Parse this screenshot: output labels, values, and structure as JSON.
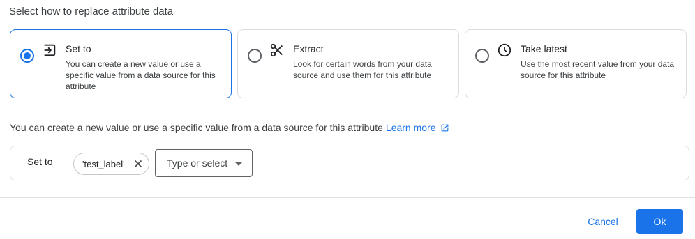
{
  "heading": "Select how to replace attribute data",
  "options": [
    {
      "title": "Set to",
      "description": "You can create a new value or use a specific value from a data source for this attribute",
      "icon": "input-arrow-icon",
      "selected": true
    },
    {
      "title": "Extract",
      "description": "Look for certain words from your data source and use them for this attribute",
      "icon": "scissors-icon",
      "selected": false
    },
    {
      "title": "Take latest",
      "description": "Use the most recent value from your data source for this attribute",
      "icon": "clock-icon",
      "selected": false
    }
  ],
  "info": {
    "text": "You can create a new value or use a specific value from a data source for this attribute",
    "link": "Learn more",
    "link_icon": "open-in-new-icon"
  },
  "set_row": {
    "label": "Set to",
    "chip": "'test_label'",
    "select_placeholder": "Type or select"
  },
  "footer": {
    "cancel": "Cancel",
    "ok": "Ok"
  },
  "colors": {
    "accent": "#1a73e8",
    "border": "#dadce0"
  }
}
